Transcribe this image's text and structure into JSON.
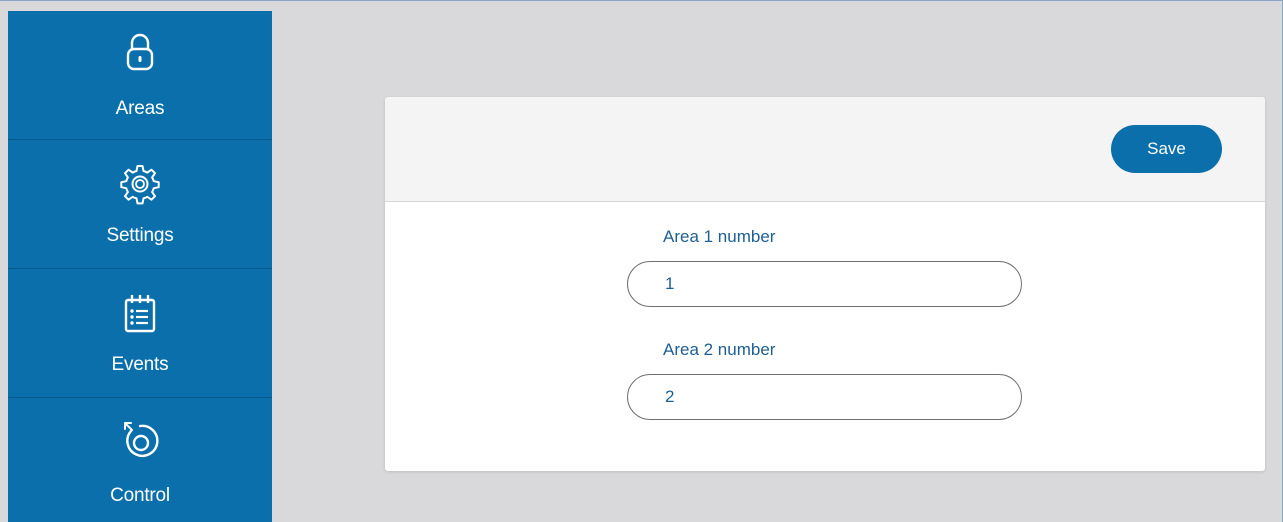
{
  "sidebar": {
    "items": [
      {
        "label": "Areas",
        "icon": "lock-icon"
      },
      {
        "label": "Settings",
        "icon": "gear-icon"
      },
      {
        "label": "Events",
        "icon": "calendar-list-icon"
      },
      {
        "label": "Control",
        "icon": "rotate-arrow-icon"
      }
    ]
  },
  "form": {
    "save_label": "Save",
    "fields": [
      {
        "label": "Area 1 number",
        "value": "1"
      },
      {
        "label": "Area 2 number",
        "value": "2"
      }
    ]
  },
  "colors": {
    "sidebar": "#0a6fab",
    "accent": "#0a6fab",
    "label_text": "#1d5f93",
    "background": "#d9d9dc"
  }
}
